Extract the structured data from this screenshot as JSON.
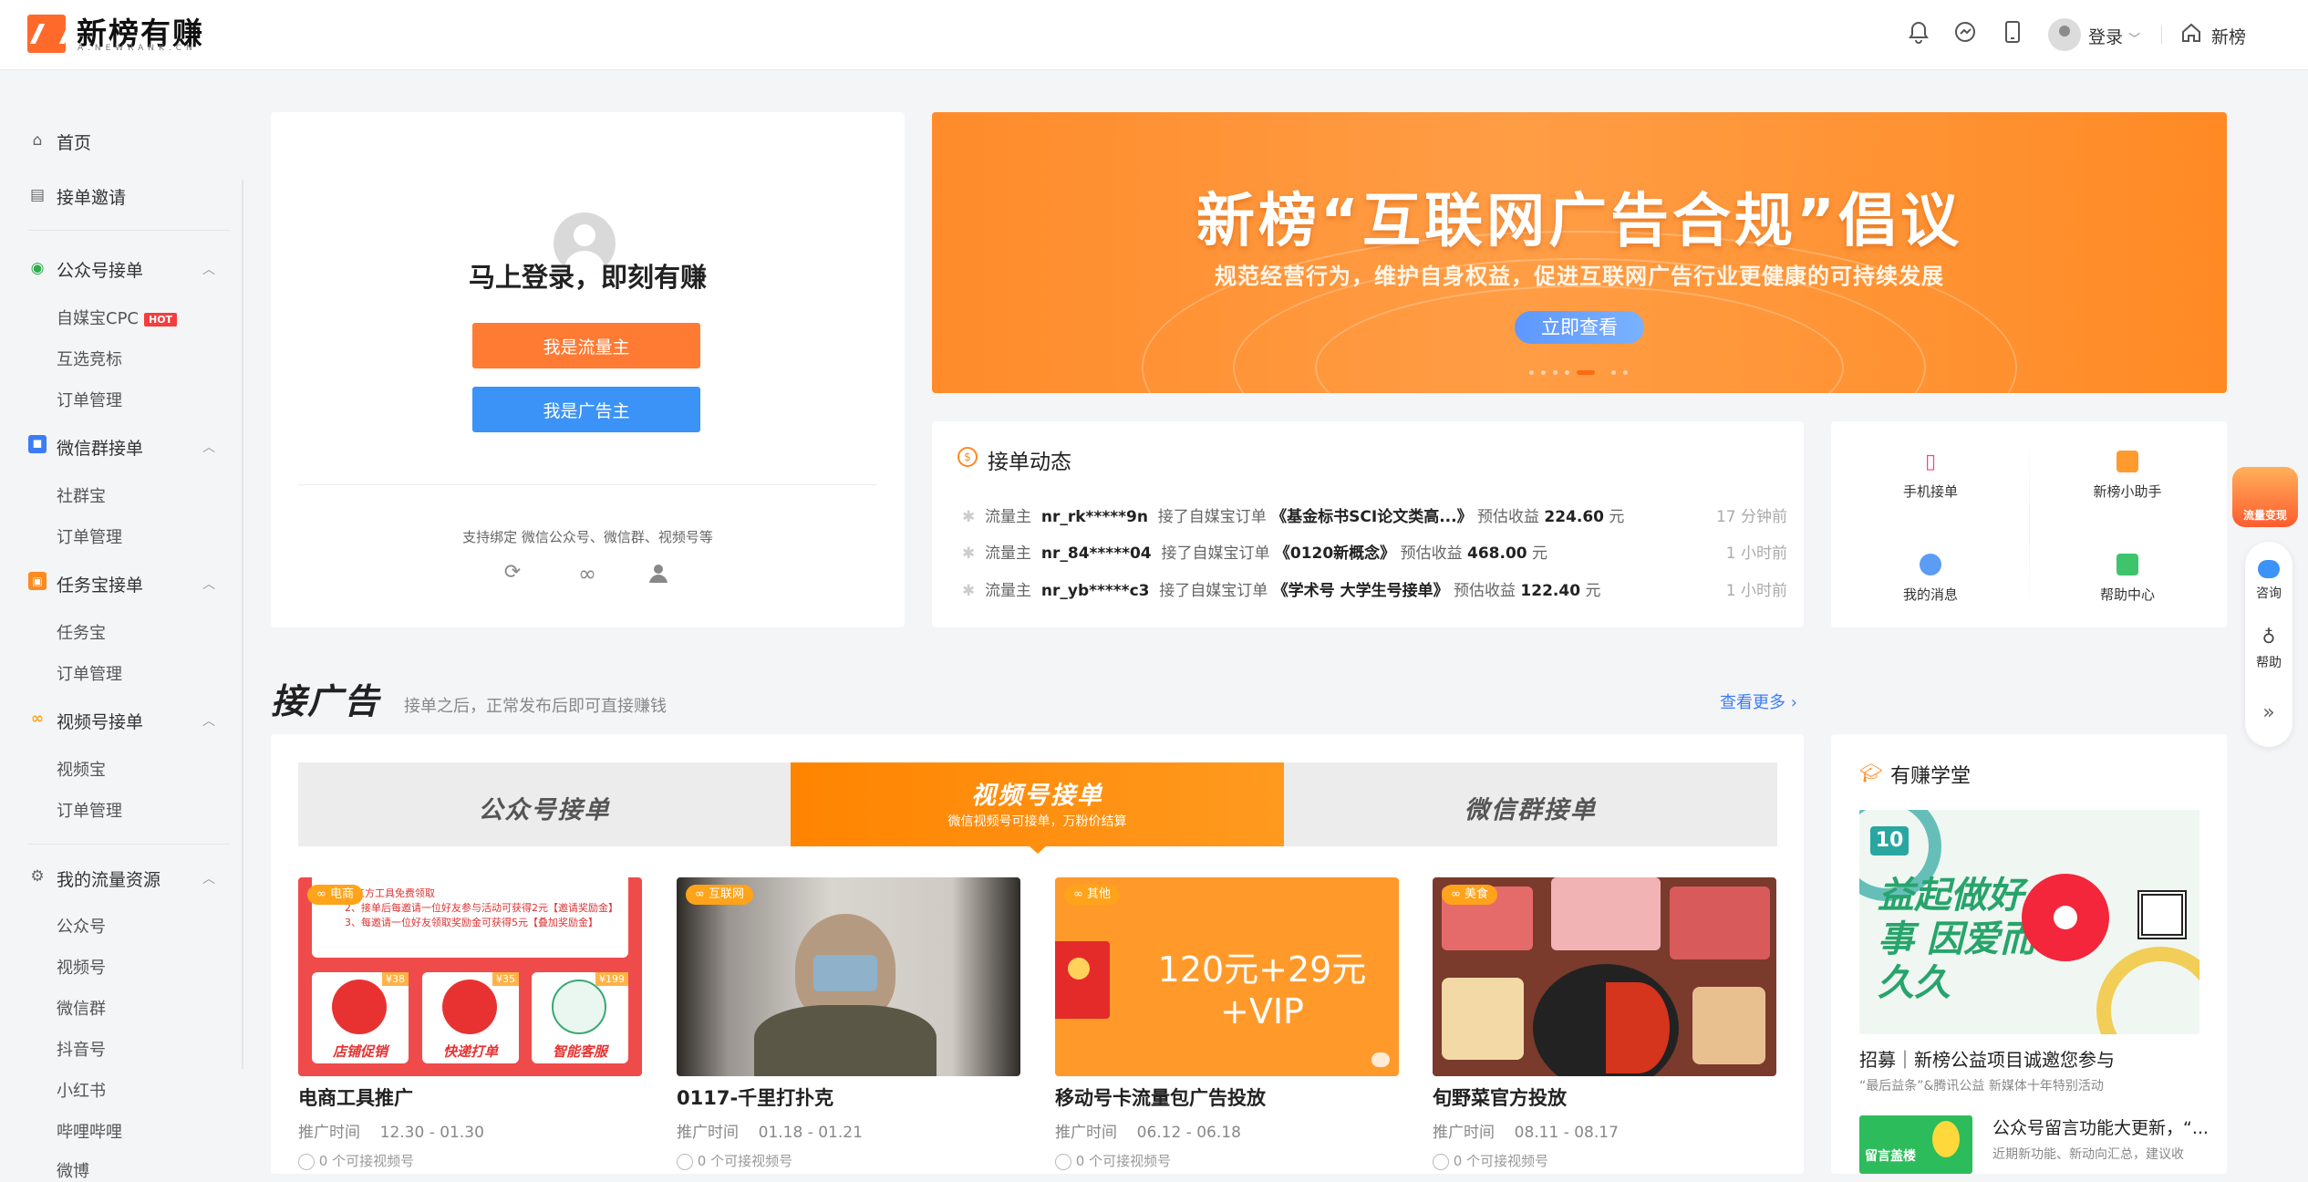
{
  "header": {
    "logo_title": "新榜有赚",
    "logo_sub": "A.NEWRANK.CN",
    "login_label": "登录",
    "home_label": "新榜"
  },
  "sidebar": {
    "home": "首页",
    "invite": "接单邀请",
    "groups": [
      {
        "title": "公众号接单",
        "items": [
          "自媒宝CPC",
          "互选竞标",
          "订单管理"
        ],
        "hot": "HOT"
      },
      {
        "title": "微信群接单",
        "items": [
          "社群宝",
          "订单管理"
        ]
      },
      {
        "title": "任务宝接单",
        "items": [
          "任务宝",
          "订单管理"
        ]
      },
      {
        "title": "视频号接单",
        "items": [
          "视频宝",
          "订单管理"
        ]
      },
      {
        "title": "我的流量资源",
        "items": [
          "公众号",
          "视频号",
          "微信群",
          "抖音号",
          "小红书",
          "哔哩哔哩",
          "微博"
        ]
      }
    ]
  },
  "login_card": {
    "title": "马上登录，即刻有赚",
    "btn_traffic": "我是流量主",
    "btn_advertiser": "我是广告主",
    "bind_text": "支持绑定 微信公众号、微信群、视频号等"
  },
  "banner": {
    "title": "新榜“互联网广告合规”倡议",
    "subtitle": "规范经营行为，维护自身权益，促进互联网广告行业更健康的可持续发展",
    "button": "立即查看"
  },
  "feed": {
    "title": "接单动态",
    "rows": [
      {
        "role": "流量主",
        "user": "nr_rk*****9n",
        "action": "接了自媒宝订单",
        "order": "《基金标书SCI论文类高...》",
        "est": "预估收益",
        "amount": "224.60",
        "unit": "元",
        "time": "17 分钟前"
      },
      {
        "role": "流量主",
        "user": "nr_84*****04",
        "action": "接了自媒宝订单",
        "order": "《0120新概念》",
        "est": "预估收益",
        "amount": "468.00",
        "unit": "元",
        "time": "1 小时前"
      },
      {
        "role": "流量主",
        "user": "nr_yb*****c3",
        "action": "接了自媒宝订单",
        "order": "《学术号 大学生号接单》",
        "est": "预估收益",
        "amount": "122.40",
        "unit": "元",
        "time": "1 小时前"
      }
    ]
  },
  "quick": [
    "手机接单",
    "新榜小助手",
    "我的消息",
    "帮助中心"
  ],
  "float_bar": {
    "promo": "流量变现",
    "consult": "咨询",
    "help": "帮助",
    "expand": "»"
  },
  "section": {
    "title": "接广告",
    "subtitle": "接单之后，正常发布后即可直接赚钱",
    "more": "查看更多"
  },
  "tabs": [
    {
      "label": "公众号接单"
    },
    {
      "label": "视频号接单",
      "sub": "微信视频号可接单，万粉价结算"
    },
    {
      "label": "微信群接单"
    }
  ],
  "cards": [
    {
      "tag": "电商",
      "title": "电商工具推广",
      "date_label": "推广时间",
      "date": "12.30 - 01.30",
      "count": "0 个可接视频号",
      "thumb_lines": [
        "第三方工具免费领取",
        "2、接单后每邀请一位好友参与活动可获得2元【邀请奖励金】",
        "3、每邀请一位好友领取奖励金可获得5元【叠加奖励金】"
      ],
      "apps": [
        {
          "name": "店铺促销",
          "price": "¥38"
        },
        {
          "name": "快递打单",
          "price": "¥35"
        },
        {
          "name": "智能客服",
          "price": "¥199"
        }
      ]
    },
    {
      "tag": "互联网",
      "title": "0117-千里打扑克",
      "date_label": "推广时间",
      "date": "01.18 - 01.21",
      "count": "0 个可接视频号"
    },
    {
      "tag": "其他",
      "title": "移动号卡流量包广告投放",
      "date_label": "推广时间",
      "date": "06.12 - 06.18",
      "count": "0 个可接视频号",
      "thumb_text": "120元+29元+VIP"
    },
    {
      "tag": "美食",
      "title": "旬野菜官方投放",
      "date_label": "推广时间",
      "date": "08.11 - 08.17",
      "count": "0 个可接视频号"
    }
  ],
  "academy": {
    "title": "有赚学堂",
    "poster_text": "益起做好事 因爱而久久",
    "article1_title": "招募｜新榜公益项目诚邀您参与",
    "article1_sub": "“最后益条”&腾讯公益 新媒体十年特别活动",
    "article2_title": "公众号留言功能大更新，“...",
    "article2_sub": "近期新功能、新动向汇总，建议收",
    "article2_thumb": "留言盖楼"
  },
  "colors": {
    "brand": "#ff6a2b",
    "blue": "#3c93f7",
    "orange": "#ff7a33",
    "link": "#3c7df5"
  }
}
